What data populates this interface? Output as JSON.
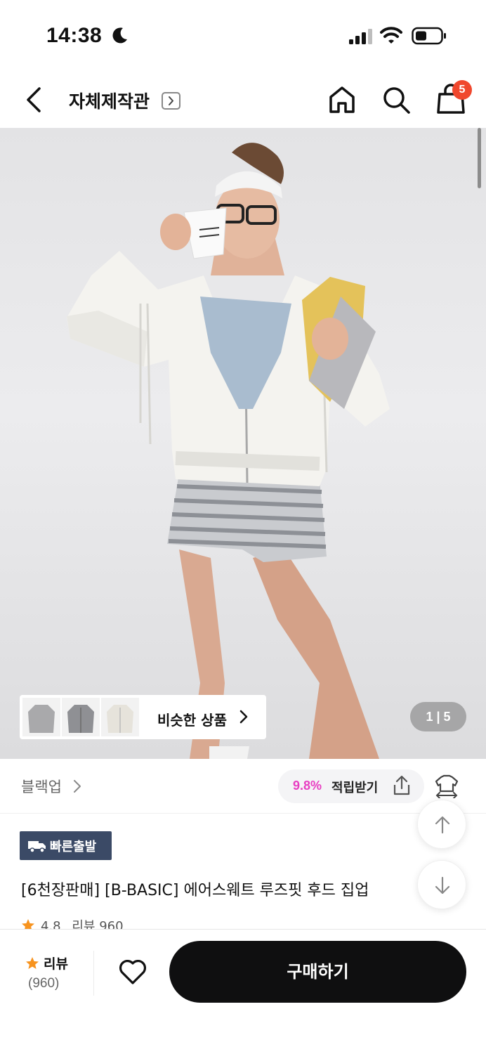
{
  "status_bar": {
    "time": "14:38",
    "icons": [
      "moon-icon",
      "cellular-signal-icon",
      "wifi-icon",
      "battery-icon"
    ]
  },
  "header": {
    "title": "자체제작관",
    "cart_badge": "5",
    "icons": [
      "back-arrow-icon",
      "chevron-right-icon",
      "home-icon",
      "search-icon",
      "shopping-bag-icon"
    ]
  },
  "gallery": {
    "pager": "1 | 5",
    "similar_label": "비슷한 상품",
    "similar_thumbnails": [
      "grey-hoodie-thumbnail",
      "grey-zip-hoodie-thumbnail",
      "ivory-zip-hoodie-thumbnail"
    ]
  },
  "brand_row": {
    "brand": "블랙업",
    "points_rate": "9.8%",
    "points_label": "적립받기",
    "icons": [
      "share-icon",
      "fit-compare-icon"
    ]
  },
  "product": {
    "fast_badge": "빠른출발",
    "title": "[6천장판매] [B-BASIC] 에어스웨트 루즈핏 후드 집업",
    "rating": "4.8",
    "review_label": "리뷰 960"
  },
  "bottom_bar": {
    "review_label": "리뷰",
    "review_count": "(960)",
    "buy_label": "구매하기"
  },
  "colors": {
    "badge_red": "#f0482e",
    "points_pink": "#e83fc2",
    "fast_badge_navy": "#3b4a66",
    "buy_black": "#0f0f10",
    "star_orange": "#f7931e"
  }
}
